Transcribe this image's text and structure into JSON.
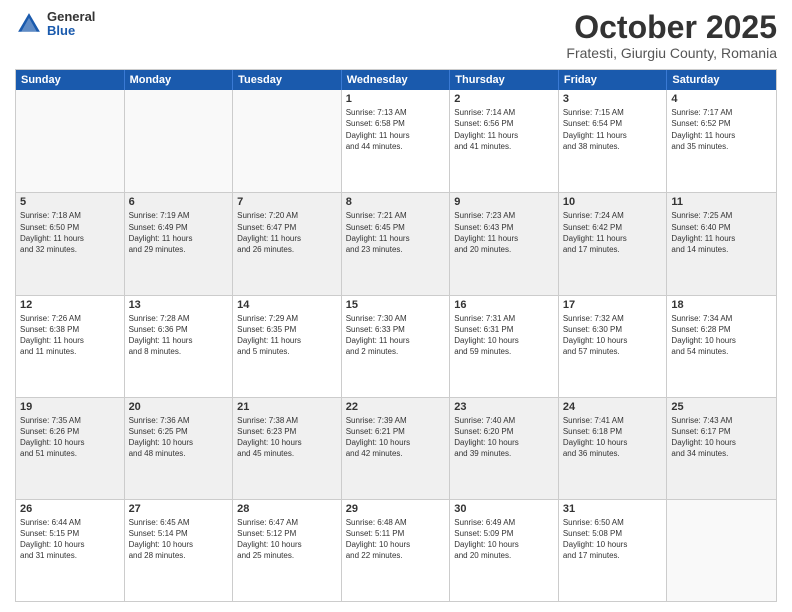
{
  "logo": {
    "general": "General",
    "blue": "Blue"
  },
  "header": {
    "month": "October 2025",
    "location": "Fratesti, Giurgiu County, Romania"
  },
  "days": [
    "Sunday",
    "Monday",
    "Tuesday",
    "Wednesday",
    "Thursday",
    "Friday",
    "Saturday"
  ],
  "weeks": [
    {
      "cells": [
        {
          "day": "",
          "info": ""
        },
        {
          "day": "",
          "info": ""
        },
        {
          "day": "",
          "info": ""
        },
        {
          "day": "1",
          "info": "Sunrise: 7:13 AM\nSunset: 6:58 PM\nDaylight: 11 hours\nand 44 minutes."
        },
        {
          "day": "2",
          "info": "Sunrise: 7:14 AM\nSunset: 6:56 PM\nDaylight: 11 hours\nand 41 minutes."
        },
        {
          "day": "3",
          "info": "Sunrise: 7:15 AM\nSunset: 6:54 PM\nDaylight: 11 hours\nand 38 minutes."
        },
        {
          "day": "4",
          "info": "Sunrise: 7:17 AM\nSunset: 6:52 PM\nDaylight: 11 hours\nand 35 minutes."
        }
      ]
    },
    {
      "cells": [
        {
          "day": "5",
          "info": "Sunrise: 7:18 AM\nSunset: 6:50 PM\nDaylight: 11 hours\nand 32 minutes."
        },
        {
          "day": "6",
          "info": "Sunrise: 7:19 AM\nSunset: 6:49 PM\nDaylight: 11 hours\nand 29 minutes."
        },
        {
          "day": "7",
          "info": "Sunrise: 7:20 AM\nSunset: 6:47 PM\nDaylight: 11 hours\nand 26 minutes."
        },
        {
          "day": "8",
          "info": "Sunrise: 7:21 AM\nSunset: 6:45 PM\nDaylight: 11 hours\nand 23 minutes."
        },
        {
          "day": "9",
          "info": "Sunrise: 7:23 AM\nSunset: 6:43 PM\nDaylight: 11 hours\nand 20 minutes."
        },
        {
          "day": "10",
          "info": "Sunrise: 7:24 AM\nSunset: 6:42 PM\nDaylight: 11 hours\nand 17 minutes."
        },
        {
          "day": "11",
          "info": "Sunrise: 7:25 AM\nSunset: 6:40 PM\nDaylight: 11 hours\nand 14 minutes."
        }
      ]
    },
    {
      "cells": [
        {
          "day": "12",
          "info": "Sunrise: 7:26 AM\nSunset: 6:38 PM\nDaylight: 11 hours\nand 11 minutes."
        },
        {
          "day": "13",
          "info": "Sunrise: 7:28 AM\nSunset: 6:36 PM\nDaylight: 11 hours\nand 8 minutes."
        },
        {
          "day": "14",
          "info": "Sunrise: 7:29 AM\nSunset: 6:35 PM\nDaylight: 11 hours\nand 5 minutes."
        },
        {
          "day": "15",
          "info": "Sunrise: 7:30 AM\nSunset: 6:33 PM\nDaylight: 11 hours\nand 2 minutes."
        },
        {
          "day": "16",
          "info": "Sunrise: 7:31 AM\nSunset: 6:31 PM\nDaylight: 10 hours\nand 59 minutes."
        },
        {
          "day": "17",
          "info": "Sunrise: 7:32 AM\nSunset: 6:30 PM\nDaylight: 10 hours\nand 57 minutes."
        },
        {
          "day": "18",
          "info": "Sunrise: 7:34 AM\nSunset: 6:28 PM\nDaylight: 10 hours\nand 54 minutes."
        }
      ]
    },
    {
      "cells": [
        {
          "day": "19",
          "info": "Sunrise: 7:35 AM\nSunset: 6:26 PM\nDaylight: 10 hours\nand 51 minutes."
        },
        {
          "day": "20",
          "info": "Sunrise: 7:36 AM\nSunset: 6:25 PM\nDaylight: 10 hours\nand 48 minutes."
        },
        {
          "day": "21",
          "info": "Sunrise: 7:38 AM\nSunset: 6:23 PM\nDaylight: 10 hours\nand 45 minutes."
        },
        {
          "day": "22",
          "info": "Sunrise: 7:39 AM\nSunset: 6:21 PM\nDaylight: 10 hours\nand 42 minutes."
        },
        {
          "day": "23",
          "info": "Sunrise: 7:40 AM\nSunset: 6:20 PM\nDaylight: 10 hours\nand 39 minutes."
        },
        {
          "day": "24",
          "info": "Sunrise: 7:41 AM\nSunset: 6:18 PM\nDaylight: 10 hours\nand 36 minutes."
        },
        {
          "day": "25",
          "info": "Sunrise: 7:43 AM\nSunset: 6:17 PM\nDaylight: 10 hours\nand 34 minutes."
        }
      ]
    },
    {
      "cells": [
        {
          "day": "26",
          "info": "Sunrise: 6:44 AM\nSunset: 5:15 PM\nDaylight: 10 hours\nand 31 minutes."
        },
        {
          "day": "27",
          "info": "Sunrise: 6:45 AM\nSunset: 5:14 PM\nDaylight: 10 hours\nand 28 minutes."
        },
        {
          "day": "28",
          "info": "Sunrise: 6:47 AM\nSunset: 5:12 PM\nDaylight: 10 hours\nand 25 minutes."
        },
        {
          "day": "29",
          "info": "Sunrise: 6:48 AM\nSunset: 5:11 PM\nDaylight: 10 hours\nand 22 minutes."
        },
        {
          "day": "30",
          "info": "Sunrise: 6:49 AM\nSunset: 5:09 PM\nDaylight: 10 hours\nand 20 minutes."
        },
        {
          "day": "31",
          "info": "Sunrise: 6:50 AM\nSunset: 5:08 PM\nDaylight: 10 hours\nand 17 minutes."
        },
        {
          "day": "",
          "info": ""
        }
      ]
    }
  ]
}
